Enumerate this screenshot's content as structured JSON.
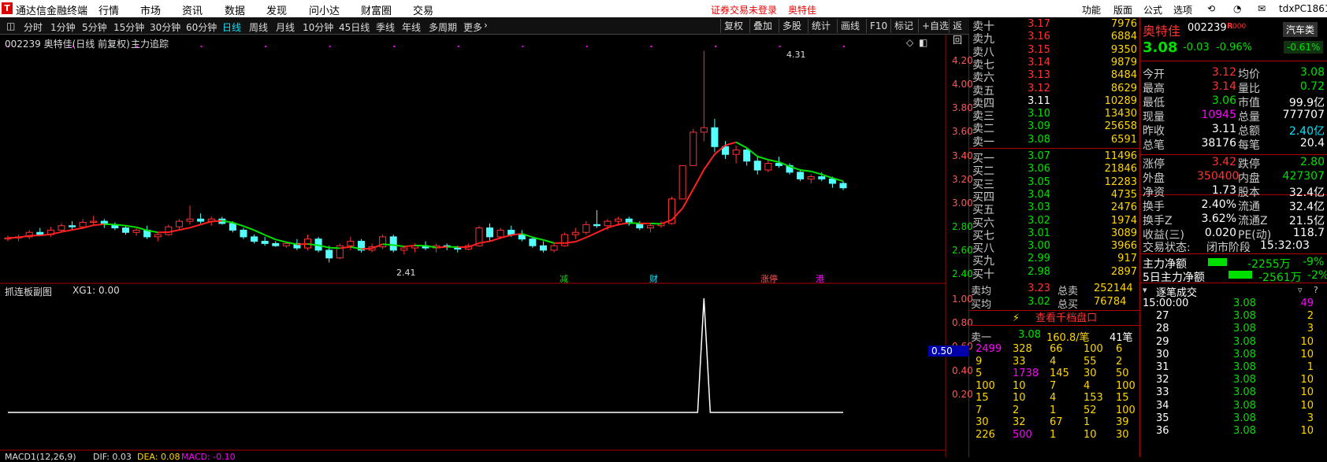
{
  "app": {
    "logo": "T",
    "title": "通达信金融终端",
    "menu": [
      "行情",
      "市场",
      "资讯",
      "数据",
      "发现",
      "问小达",
      "财富圈",
      "交易"
    ],
    "notice": "证券交易未登录",
    "notice_stock": "奥特佳",
    "right_menu": [
      "功能",
      "版面",
      "公式",
      "选项"
    ],
    "user": "tdxPC1861"
  },
  "toolbar": {
    "periods": [
      "分时",
      "1分钟",
      "5分钟",
      "15分钟",
      "30分钟",
      "60分钟",
      "日线",
      "周线",
      "月线",
      "10分钟",
      "45日线",
      "季线",
      "年线",
      "多周期",
      "更多"
    ],
    "selected": "日线",
    "right": [
      "复权",
      "叠加",
      "多股",
      "统计",
      "画线",
      "F10",
      "标记",
      "+自选",
      "返回"
    ]
  },
  "chart": {
    "main_title": "002239 奥特佳(日线 前复权)",
    "indicator": "主力追踪",
    "high_label": "4.31",
    "low_label": "2.41",
    "events": [
      "减",
      "财",
      "涨停",
      "港"
    ],
    "sub_title": "抓连板副图",
    "sub_value": "XG1: 0.00",
    "sub_marker": "0.50",
    "macd": "MACD1(12,26,9)",
    "dif": "DIF: 0.03",
    "dea": "DEA: 0.08",
    "macdv": "MACD: -0.10",
    "price_ticks": [
      "4.20",
      "4.00",
      "3.80",
      "3.60",
      "3.40",
      "3.20",
      "3.00",
      "2.80",
      "2.60",
      "2.40"
    ],
    "sub_ticks": [
      "1.00",
      "0.80",
      "0.60",
      "0.40",
      "0.20"
    ]
  },
  "chart_data": {
    "type": "candlestick",
    "title": "002239 奥特佳(日线 前复权)",
    "ylim": [
      2.3,
      4.35
    ],
    "ohlc": [
      [
        2.62,
        2.65,
        2.6,
        2.63
      ],
      [
        2.63,
        2.66,
        2.6,
        2.64
      ],
      [
        2.64,
        2.7,
        2.62,
        2.68
      ],
      [
        2.68,
        2.72,
        2.65,
        2.66
      ],
      [
        2.66,
        2.73,
        2.64,
        2.7
      ],
      [
        2.7,
        2.76,
        2.68,
        2.74
      ],
      [
        2.74,
        2.78,
        2.7,
        2.73
      ],
      [
        2.73,
        2.8,
        2.71,
        2.77
      ],
      [
        2.77,
        2.83,
        2.74,
        2.78
      ],
      [
        2.78,
        2.8,
        2.72,
        2.75
      ],
      [
        2.75,
        2.77,
        2.7,
        2.72
      ],
      [
        2.72,
        2.74,
        2.66,
        2.68
      ],
      [
        2.68,
        2.72,
        2.65,
        2.7
      ],
      [
        2.7,
        2.74,
        2.62,
        2.64
      ],
      [
        2.64,
        2.68,
        2.6,
        2.66
      ],
      [
        2.66,
        2.75,
        2.65,
        2.73
      ],
      [
        2.73,
        2.8,
        2.7,
        2.78
      ],
      [
        2.78,
        2.92,
        2.75,
        2.8
      ],
      [
        2.8,
        2.85,
        2.76,
        2.78
      ],
      [
        2.78,
        2.82,
        2.74,
        2.8
      ],
      [
        2.8,
        2.82,
        2.75,
        2.76
      ],
      [
        2.76,
        2.78,
        2.68,
        2.7
      ],
      [
        2.7,
        2.72,
        2.62,
        2.64
      ],
      [
        2.64,
        2.66,
        2.58,
        2.6
      ],
      [
        2.6,
        2.64,
        2.56,
        2.58
      ],
      [
        2.58,
        2.6,
        2.55,
        2.56
      ],
      [
        2.56,
        2.6,
        2.54,
        2.58
      ],
      [
        2.58,
        2.62,
        2.52,
        2.54
      ],
      [
        2.54,
        2.66,
        2.52,
        2.62
      ],
      [
        2.62,
        2.64,
        2.5,
        2.52
      ],
      [
        2.52,
        2.56,
        2.41,
        2.45
      ],
      [
        2.45,
        2.58,
        2.44,
        2.56
      ],
      [
        2.56,
        2.64,
        2.52,
        2.6
      ],
      [
        2.6,
        2.62,
        2.5,
        2.52
      ],
      [
        2.52,
        2.58,
        2.5,
        2.55
      ],
      [
        2.55,
        2.66,
        2.53,
        2.64
      ],
      [
        2.64,
        2.66,
        2.5,
        2.52
      ],
      [
        2.52,
        2.56,
        2.48,
        2.54
      ],
      [
        2.54,
        2.58,
        2.5,
        2.56
      ],
      [
        2.56,
        2.6,
        2.52,
        2.54
      ],
      [
        2.54,
        2.58,
        2.5,
        2.56
      ],
      [
        2.56,
        2.58,
        2.52,
        2.55
      ],
      [
        2.55,
        2.56,
        2.5,
        2.53
      ],
      [
        2.53,
        2.58,
        2.52,
        2.56
      ],
      [
        2.56,
        2.74,
        2.55,
        2.72
      ],
      [
        2.72,
        2.76,
        2.6,
        2.64
      ],
      [
        2.64,
        2.72,
        2.62,
        2.7
      ],
      [
        2.7,
        2.74,
        2.64,
        2.66
      ],
      [
        2.66,
        2.7,
        2.6,
        2.62
      ],
      [
        2.62,
        2.64,
        2.54,
        2.56
      ],
      [
        2.56,
        2.6,
        2.5,
        2.52
      ],
      [
        2.52,
        2.58,
        2.5,
        2.56
      ],
      [
        2.56,
        2.68,
        2.55,
        2.66
      ],
      [
        2.66,
        2.72,
        2.62,
        2.68
      ],
      [
        2.68,
        2.78,
        2.66,
        2.75
      ],
      [
        2.75,
        2.88,
        2.72,
        2.74
      ],
      [
        2.74,
        2.8,
        2.7,
        2.78
      ],
      [
        2.78,
        2.82,
        2.74,
        2.8
      ],
      [
        2.8,
        2.82,
        2.74,
        2.76
      ],
      [
        2.76,
        2.78,
        2.7,
        2.72
      ],
      [
        2.72,
        2.76,
        2.68,
        2.74
      ],
      [
        2.74,
        2.78,
        2.72,
        2.76
      ],
      [
        2.76,
        3.0,
        2.75,
        2.98
      ],
      [
        2.98,
        3.28,
        2.98,
        3.28
      ],
      [
        3.28,
        3.61,
        3.28,
        3.58
      ],
      [
        3.58,
        4.31,
        3.5,
        3.62
      ],
      [
        3.62,
        3.7,
        3.4,
        3.45
      ],
      [
        3.45,
        3.5,
        3.34,
        3.38
      ],
      [
        3.38,
        3.46,
        3.3,
        3.42
      ],
      [
        3.42,
        3.44,
        3.28,
        3.32
      ],
      [
        3.32,
        3.36,
        3.2,
        3.24
      ],
      [
        3.24,
        3.34,
        3.22,
        3.3
      ],
      [
        3.3,
        3.36,
        3.26,
        3.28
      ],
      [
        3.28,
        3.3,
        3.2,
        3.22
      ],
      [
        3.22,
        3.24,
        3.14,
        3.16
      ],
      [
        3.16,
        3.2,
        3.12,
        3.18
      ],
      [
        3.18,
        3.22,
        3.14,
        3.16
      ],
      [
        3.16,
        3.18,
        3.08,
        3.12
      ],
      [
        3.12,
        3.14,
        3.06,
        3.08
      ]
    ]
  },
  "orderbook": {
    "asks": [
      {
        "n": "卖十",
        "p": "3.17",
        "v": "7976"
      },
      {
        "n": "卖九",
        "p": "3.16",
        "v": "6884"
      },
      {
        "n": "卖八",
        "p": "3.15",
        "v": "9350"
      },
      {
        "n": "卖七",
        "p": "3.14",
        "v": "9879"
      },
      {
        "n": "卖六",
        "p": "3.13",
        "v": "8484"
      },
      {
        "n": "卖五",
        "p": "3.12",
        "v": "8629"
      },
      {
        "n": "卖四",
        "p": "3.11",
        "v": "10289"
      },
      {
        "n": "卖三",
        "p": "3.10",
        "v": "13430"
      },
      {
        "n": "卖二",
        "p": "3.09",
        "v": "25658"
      },
      {
        "n": "卖一",
        "p": "3.08",
        "v": "6591"
      }
    ],
    "bids": [
      {
        "n": "买一",
        "p": "3.07",
        "v": "11496"
      },
      {
        "n": "买二",
        "p": "3.06",
        "v": "21846"
      },
      {
        "n": "买三",
        "p": "3.05",
        "v": "12283"
      },
      {
        "n": "买四",
        "p": "3.04",
        "v": "4735"
      },
      {
        "n": "买五",
        "p": "3.03",
        "v": "2476"
      },
      {
        "n": "买六",
        "p": "3.02",
        "v": "1974"
      },
      {
        "n": "买七",
        "p": "3.01",
        "v": "3089"
      },
      {
        "n": "买八",
        "p": "3.00",
        "v": "3966"
      },
      {
        "n": "买九",
        "p": "2.99",
        "v": "917"
      },
      {
        "n": "买十",
        "p": "2.98",
        "v": "2897"
      }
    ],
    "ask_avg_label": "卖均",
    "ask_avg": "3.23",
    "total_sell_label": "总卖",
    "total_sell": "252144",
    "bid_avg_label": "买均",
    "bid_avg": "3.02",
    "total_buy_label": "总买",
    "total_buy": "76784",
    "qian_button": "查看千档盘口",
    "queue_head": {
      "label": "卖一",
      "price": "3.08",
      "avg": "160.8/笔",
      "count": "41笔"
    },
    "queue": [
      [
        "2499",
        "328",
        "66",
        "100",
        "6"
      ],
      [
        "9",
        "33",
        "4",
        "55",
        "2"
      ],
      [
        "5",
        "1738",
        "145",
        "30",
        "50"
      ],
      [
        "100",
        "10",
        "7",
        "4",
        "100"
      ],
      [
        "15",
        "10",
        "4",
        "153",
        "15"
      ],
      [
        "7",
        "2",
        "1",
        "52",
        "100"
      ],
      [
        "30",
        "32",
        "67",
        "1",
        "39"
      ],
      [
        "226",
        "500",
        "1",
        "10",
        "30"
      ]
    ]
  },
  "quote": {
    "name": "奥特佳",
    "code": "002239",
    "tag": "R",
    "tag2": "000",
    "sector": "汽车类",
    "price": "3.08",
    "change": "-0.03",
    "pct": "-0.96%",
    "sector_pct": "-0.61%",
    "rows": [
      [
        "今开",
        "3.12",
        "均价",
        "3.08"
      ],
      [
        "最高",
        "3.14",
        "量比",
        "0.72"
      ],
      [
        "最低",
        "3.06",
        "市值",
        "99.9亿"
      ],
      [
        "现量",
        "10945",
        "总量",
        "777707"
      ],
      [
        "昨收",
        "3.11",
        "总额",
        "2.40亿"
      ],
      [
        "总笔",
        "38176",
        "每笔",
        "20.4"
      ],
      [
        "涨停",
        "3.42",
        "跌停",
        "2.80"
      ],
      [
        "外盘",
        "350400",
        "内盘",
        "427307"
      ],
      [
        "净资",
        "1.73",
        "股本",
        "32.4亿"
      ],
      [
        "换手",
        "2.40%",
        "流通",
        "32.4亿"
      ],
      [
        "换手Z",
        "3.62%",
        "流通Z",
        "21.5亿"
      ],
      [
        "收益(三)",
        "0.020",
        "PE(动)",
        "118.7"
      ]
    ],
    "status_label": "交易状态:",
    "status": "闭市阶段",
    "time": "15:32:03",
    "flow1_label": "主力净额",
    "flow1_val": "-2255万",
    "flow1_pct": "-9%",
    "flow2_label": "5日主力净额",
    "flow2_val": "-2561万",
    "flow2_pct": "-2%",
    "ticks_title": "逐笔成交",
    "ticks": [
      [
        "15:00:00",
        "3.08",
        "49"
      ],
      [
        "27",
        "3.08",
        "2"
      ],
      [
        "28",
        "3.08",
        "3"
      ],
      [
        "29",
        "3.08",
        "10"
      ],
      [
        "30",
        "3.08",
        "10"
      ],
      [
        "31",
        "3.08",
        "1"
      ],
      [
        "32",
        "3.08",
        "10"
      ],
      [
        "33",
        "3.08",
        "10"
      ],
      [
        "34",
        "3.08",
        "10"
      ],
      [
        "35",
        "3.08",
        "3"
      ],
      [
        "36",
        "3.08",
        "10"
      ]
    ]
  }
}
